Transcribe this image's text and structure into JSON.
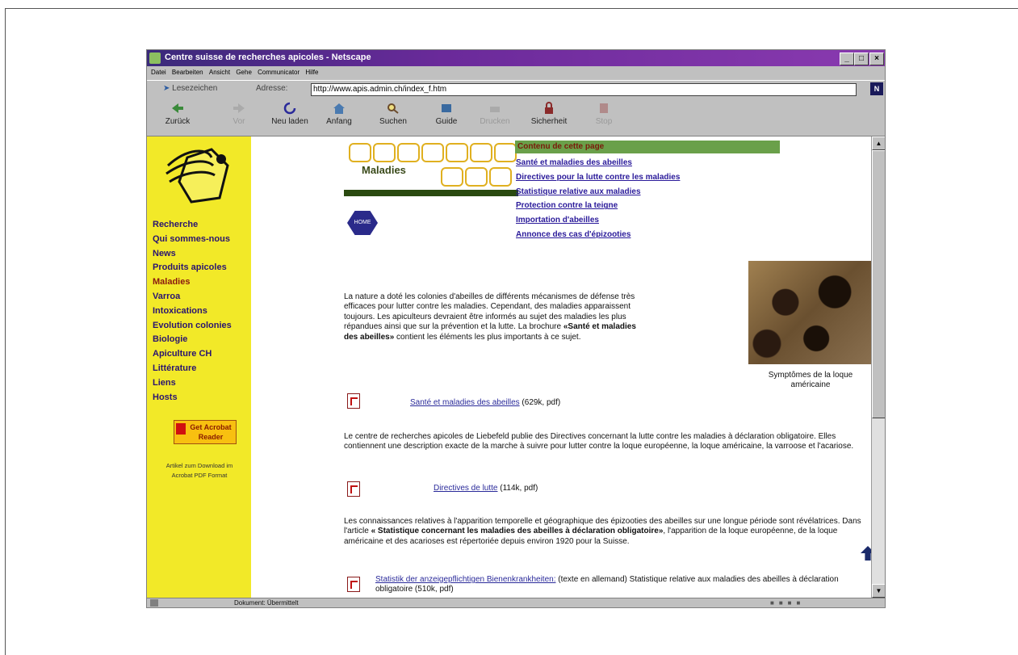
{
  "window": {
    "title": "Centre suisse de recherches apicoles - Netscape",
    "controls": [
      "_",
      "□",
      "×"
    ]
  },
  "menu": [
    "Datei",
    "Bearbeiten",
    "Ansicht",
    "Gehe",
    "Communicator",
    "Hilfe"
  ],
  "location": {
    "bookmarks_label": "Lesezeichen",
    "address_label": "Adresse:",
    "url": "http://www.apis.admin.ch/index_f.htm",
    "brand": "N"
  },
  "toolbar": {
    "buttons": [
      {
        "label": "Zurück",
        "icon": "back-arrow-icon",
        "enabled": true
      },
      {
        "label": "Vor",
        "icon": "forward-arrow-icon",
        "enabled": false
      },
      {
        "label": "Neu laden",
        "icon": "reload-icon",
        "enabled": true
      },
      {
        "label": "Anfang",
        "icon": "home-icon",
        "enabled": true
      },
      {
        "label": "Suchen",
        "icon": "search-icon",
        "enabled": true
      },
      {
        "label": "Guide",
        "icon": "guide-icon",
        "enabled": true
      },
      {
        "label": "Drucken",
        "icon": "print-icon",
        "enabled": false
      },
      {
        "label": "Sicherheit",
        "icon": "lock-icon",
        "enabled": true
      },
      {
        "label": "Stop",
        "icon": "stop-icon",
        "enabled": false
      }
    ]
  },
  "sidebar": {
    "items": [
      {
        "label": "Recherche",
        "active": false
      },
      {
        "label": "Qui sommes-nous",
        "active": false
      },
      {
        "label": "News",
        "active": false
      },
      {
        "label": "Produits apicoles",
        "active": false
      },
      {
        "label": "Maladies",
        "active": true
      },
      {
        "label": "Varroa",
        "active": false
      },
      {
        "label": "Intoxications",
        "active": false
      },
      {
        "label": "Evolution colonies",
        "active": false
      },
      {
        "label": "Biologie",
        "active": false
      },
      {
        "label": "Apiculture CH",
        "active": false
      },
      {
        "label": "Littérature",
        "active": false
      },
      {
        "label": "Liens",
        "active": false
      },
      {
        "label": "Hosts",
        "active": false
      }
    ],
    "acrobat_label": "Get Acrobat Reader",
    "acrobat_note": "Artikel zum Download im Acrobat PDF Format"
  },
  "page": {
    "banner_title": "Maladies",
    "home_label": "HOME",
    "toc_heading": "Contenu de cette page",
    "toc": [
      "Santé et maladies des abeilles",
      "Directives pour la lutte contre les maladies",
      "Statistique relative aux maladies",
      "Protection contre la teigne",
      "Importation d'abeilles",
      "Annonce des cas d'épizooties"
    ],
    "intro_text": "La nature a doté les colonies d'abeilles de différents mécanismes de défense très efficaces pour lutter contre les maladies. Cependant, des maladies apparaissent toujours. Les apiculteurs devraient être informés au sujet des maladies les plus répandues ainsi que sur la prévention et la lutte. La brochure ",
    "intro_bold": "«Santé et maladies des abeilles»",
    "intro_end": " contient les éléments les plus importants à ce sujet.",
    "photo_caption": "Symptômes de la loque américaine",
    "download1_link": "Santé et maladies des abeilles",
    "download1_info": "(629k, pdf)",
    "para2": "Le centre de recherches apicoles de Liebefeld publie des Directives concernant la lutte contre les maladies à déclaration obligatoire. Elles contiennent une description exacte de la marche à suivre pour lutter contre la loque européenne, la loque américaine, la varroose et l'acariose.",
    "download2_link": "Directives de lutte",
    "download2_info": "(114k, pdf)",
    "para3_start": "Les connaissances relatives à l'apparition temporelle et géographique des épizooties des abeilles sur une longue période sont révélatrices. Dans l'article ",
    "para3_bold": "« Statistique concernant les maladies des abeilles à déclaration obligatoire»",
    "para3_end": ", l'apparition de la loque européenne, de la loque américaine et des acarioses est répertoriée depuis environ 1920 pour la Suisse.",
    "download3_link": "Statistik der anzeigepflichtigen Bienenkrankheiten:",
    "download3_info": "(texte en allemand) Statistique relative aux maladies des abeilles à déclaration obligatoire (510k, pdf)"
  },
  "status": {
    "text": "Dokument: Übermittelt"
  },
  "colors": {
    "titlebar": "#5a2a8a",
    "sidebar": "#f2e928",
    "toc_heading_bg": "#6aa04a",
    "link": "#2a1a9a"
  }
}
